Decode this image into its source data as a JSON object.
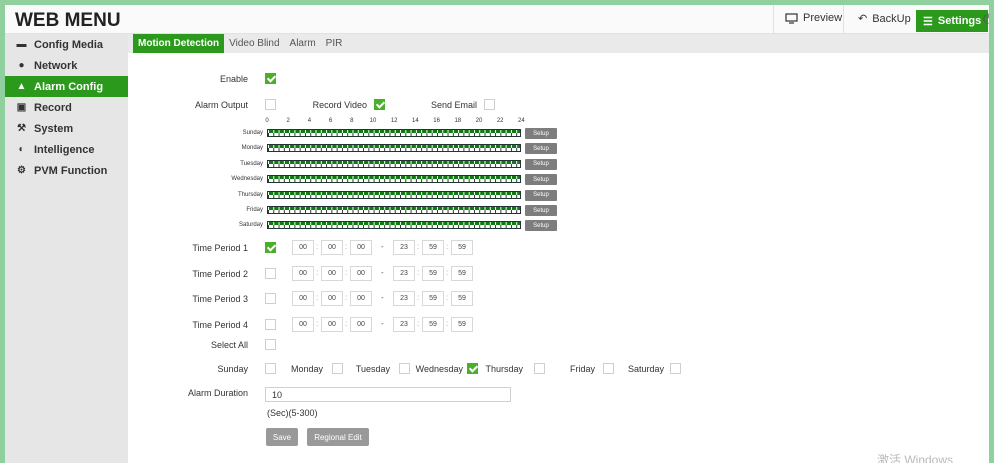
{
  "header": {
    "brand": "WEB MENU",
    "preview": "Preview",
    "backup": "BackUp",
    "settings": "Settings"
  },
  "sidebar": {
    "items": [
      {
        "label": "Config Media",
        "icon": "folder-icon"
      },
      {
        "label": "Network",
        "icon": "globe-icon"
      },
      {
        "label": "Alarm Config",
        "icon": "alarm-icon",
        "active": true
      },
      {
        "label": "Record",
        "icon": "record-icon"
      },
      {
        "label": "System",
        "icon": "wrench-icon"
      },
      {
        "label": "Intelligence",
        "icon": "intelligence-icon"
      },
      {
        "label": "PVM Function",
        "icon": "gear-icon"
      }
    ]
  },
  "tabs": [
    "Motion Detection",
    "Video Blind",
    "Alarm",
    "PIR"
  ],
  "form": {
    "enable_label": "Enable",
    "alarm_output_label": "Alarm Output",
    "record_video_label": "Record Video",
    "send_email_label": "Send Email",
    "enable_checked": true,
    "alarm_output_checked": false,
    "record_video_checked": true,
    "send_email_checked": false
  },
  "schedule": {
    "hours": [
      "0",
      "2",
      "4",
      "6",
      "8",
      "10",
      "12",
      "14",
      "16",
      "18",
      "20",
      "22",
      "24"
    ],
    "days": [
      "Sunday",
      "Monday",
      "Tuesday",
      "Wednesday",
      "Thursday",
      "Friday",
      "Saturday"
    ],
    "setup_label": "Setup"
  },
  "periods": [
    {
      "label": "Time Period 1",
      "checked": true,
      "start": [
        "00",
        "00",
        "00"
      ],
      "end": [
        "23",
        "59",
        "59"
      ]
    },
    {
      "label": "Time Period 2",
      "checked": false,
      "start": [
        "00",
        "00",
        "00"
      ],
      "end": [
        "23",
        "59",
        "59"
      ]
    },
    {
      "label": "Time Period 3",
      "checked": false,
      "start": [
        "00",
        "00",
        "00"
      ],
      "end": [
        "23",
        "59",
        "59"
      ]
    },
    {
      "label": "Time Period 4",
      "checked": false,
      "start": [
        "00",
        "00",
        "00"
      ],
      "end": [
        "23",
        "59",
        "59"
      ]
    }
  ],
  "select_all_label": "Select All",
  "weekdays": [
    {
      "label": "Sunday",
      "checked": false
    },
    {
      "label": "Monday",
      "checked": false
    },
    {
      "label": "Tuesday",
      "checked": false
    },
    {
      "label": "Wednesday",
      "checked": true
    },
    {
      "label": "Thursday",
      "checked": false
    },
    {
      "label": "Friday",
      "checked": false
    },
    {
      "label": "Saturday",
      "checked": false
    }
  ],
  "duration": {
    "label": "Alarm Duration",
    "value": "10",
    "hint": "(Sec)(5-300)"
  },
  "buttons": {
    "save": "Save",
    "regional_edit": "Regional Edit"
  },
  "watermark": "激活 Windows"
}
